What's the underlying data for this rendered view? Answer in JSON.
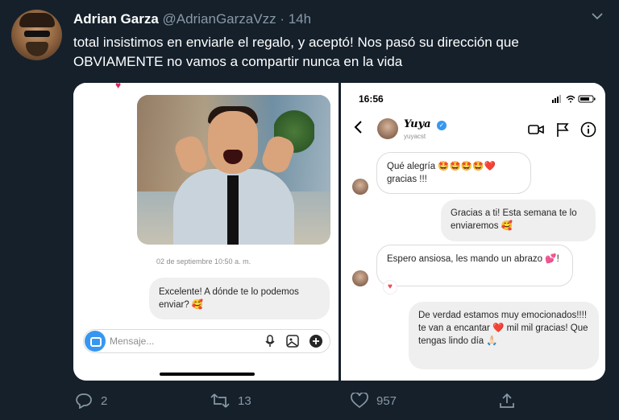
{
  "tweet": {
    "author_name": "Adrian Garza",
    "author_handle": "@AdrianGarzaVzz",
    "separator": "·",
    "time": "14h",
    "text": "total insistimos en enviarle el regalo, y aceptó! Nos pasó su dirección que OBVIAMENTE no vamos a compartir nunca en la vida"
  },
  "left_screenshot": {
    "timestamp": "02 de septiembre 10:50 a. m.",
    "outgoing_message": "Excelente! A dónde te lo podemos enviar? 🥰",
    "composer_placeholder": "Mensaje..."
  },
  "right_screenshot": {
    "status_time": "16:56",
    "contact_name": "Yuya",
    "contact_handle": "yuyacst",
    "messages": [
      {
        "direction": "in",
        "text": "Qué alegría 🤩🤩🤩🤩❤️ gracias !!!"
      },
      {
        "direction": "out",
        "text": "Gracias a ti! Esta semana te lo enviaremos 🥰"
      },
      {
        "direction": "in",
        "text": "Espero ansiosa, les mando un abrazo 💕!"
      },
      {
        "direction": "out",
        "text": "De verdad estamos muy emocionados!!!! te van a encantar ❤️ mil mil gracias! Que tengas lindo día 🙏🏻"
      }
    ]
  },
  "actions": {
    "replies": "2",
    "retweets": "13",
    "likes": "957"
  },
  "colors": {
    "background": "#15202b",
    "muted": "#8899a6",
    "instagram_blue": "#3797f0",
    "heart_red": "#ed4956"
  },
  "icons": [
    "chevron-down-icon",
    "camera-icon",
    "microphone-icon",
    "image-icon",
    "plus-icon",
    "back-icon",
    "verified-icon",
    "video-call-icon",
    "flag-icon",
    "info-icon",
    "reply-icon",
    "retweet-icon",
    "like-icon",
    "share-icon"
  ]
}
